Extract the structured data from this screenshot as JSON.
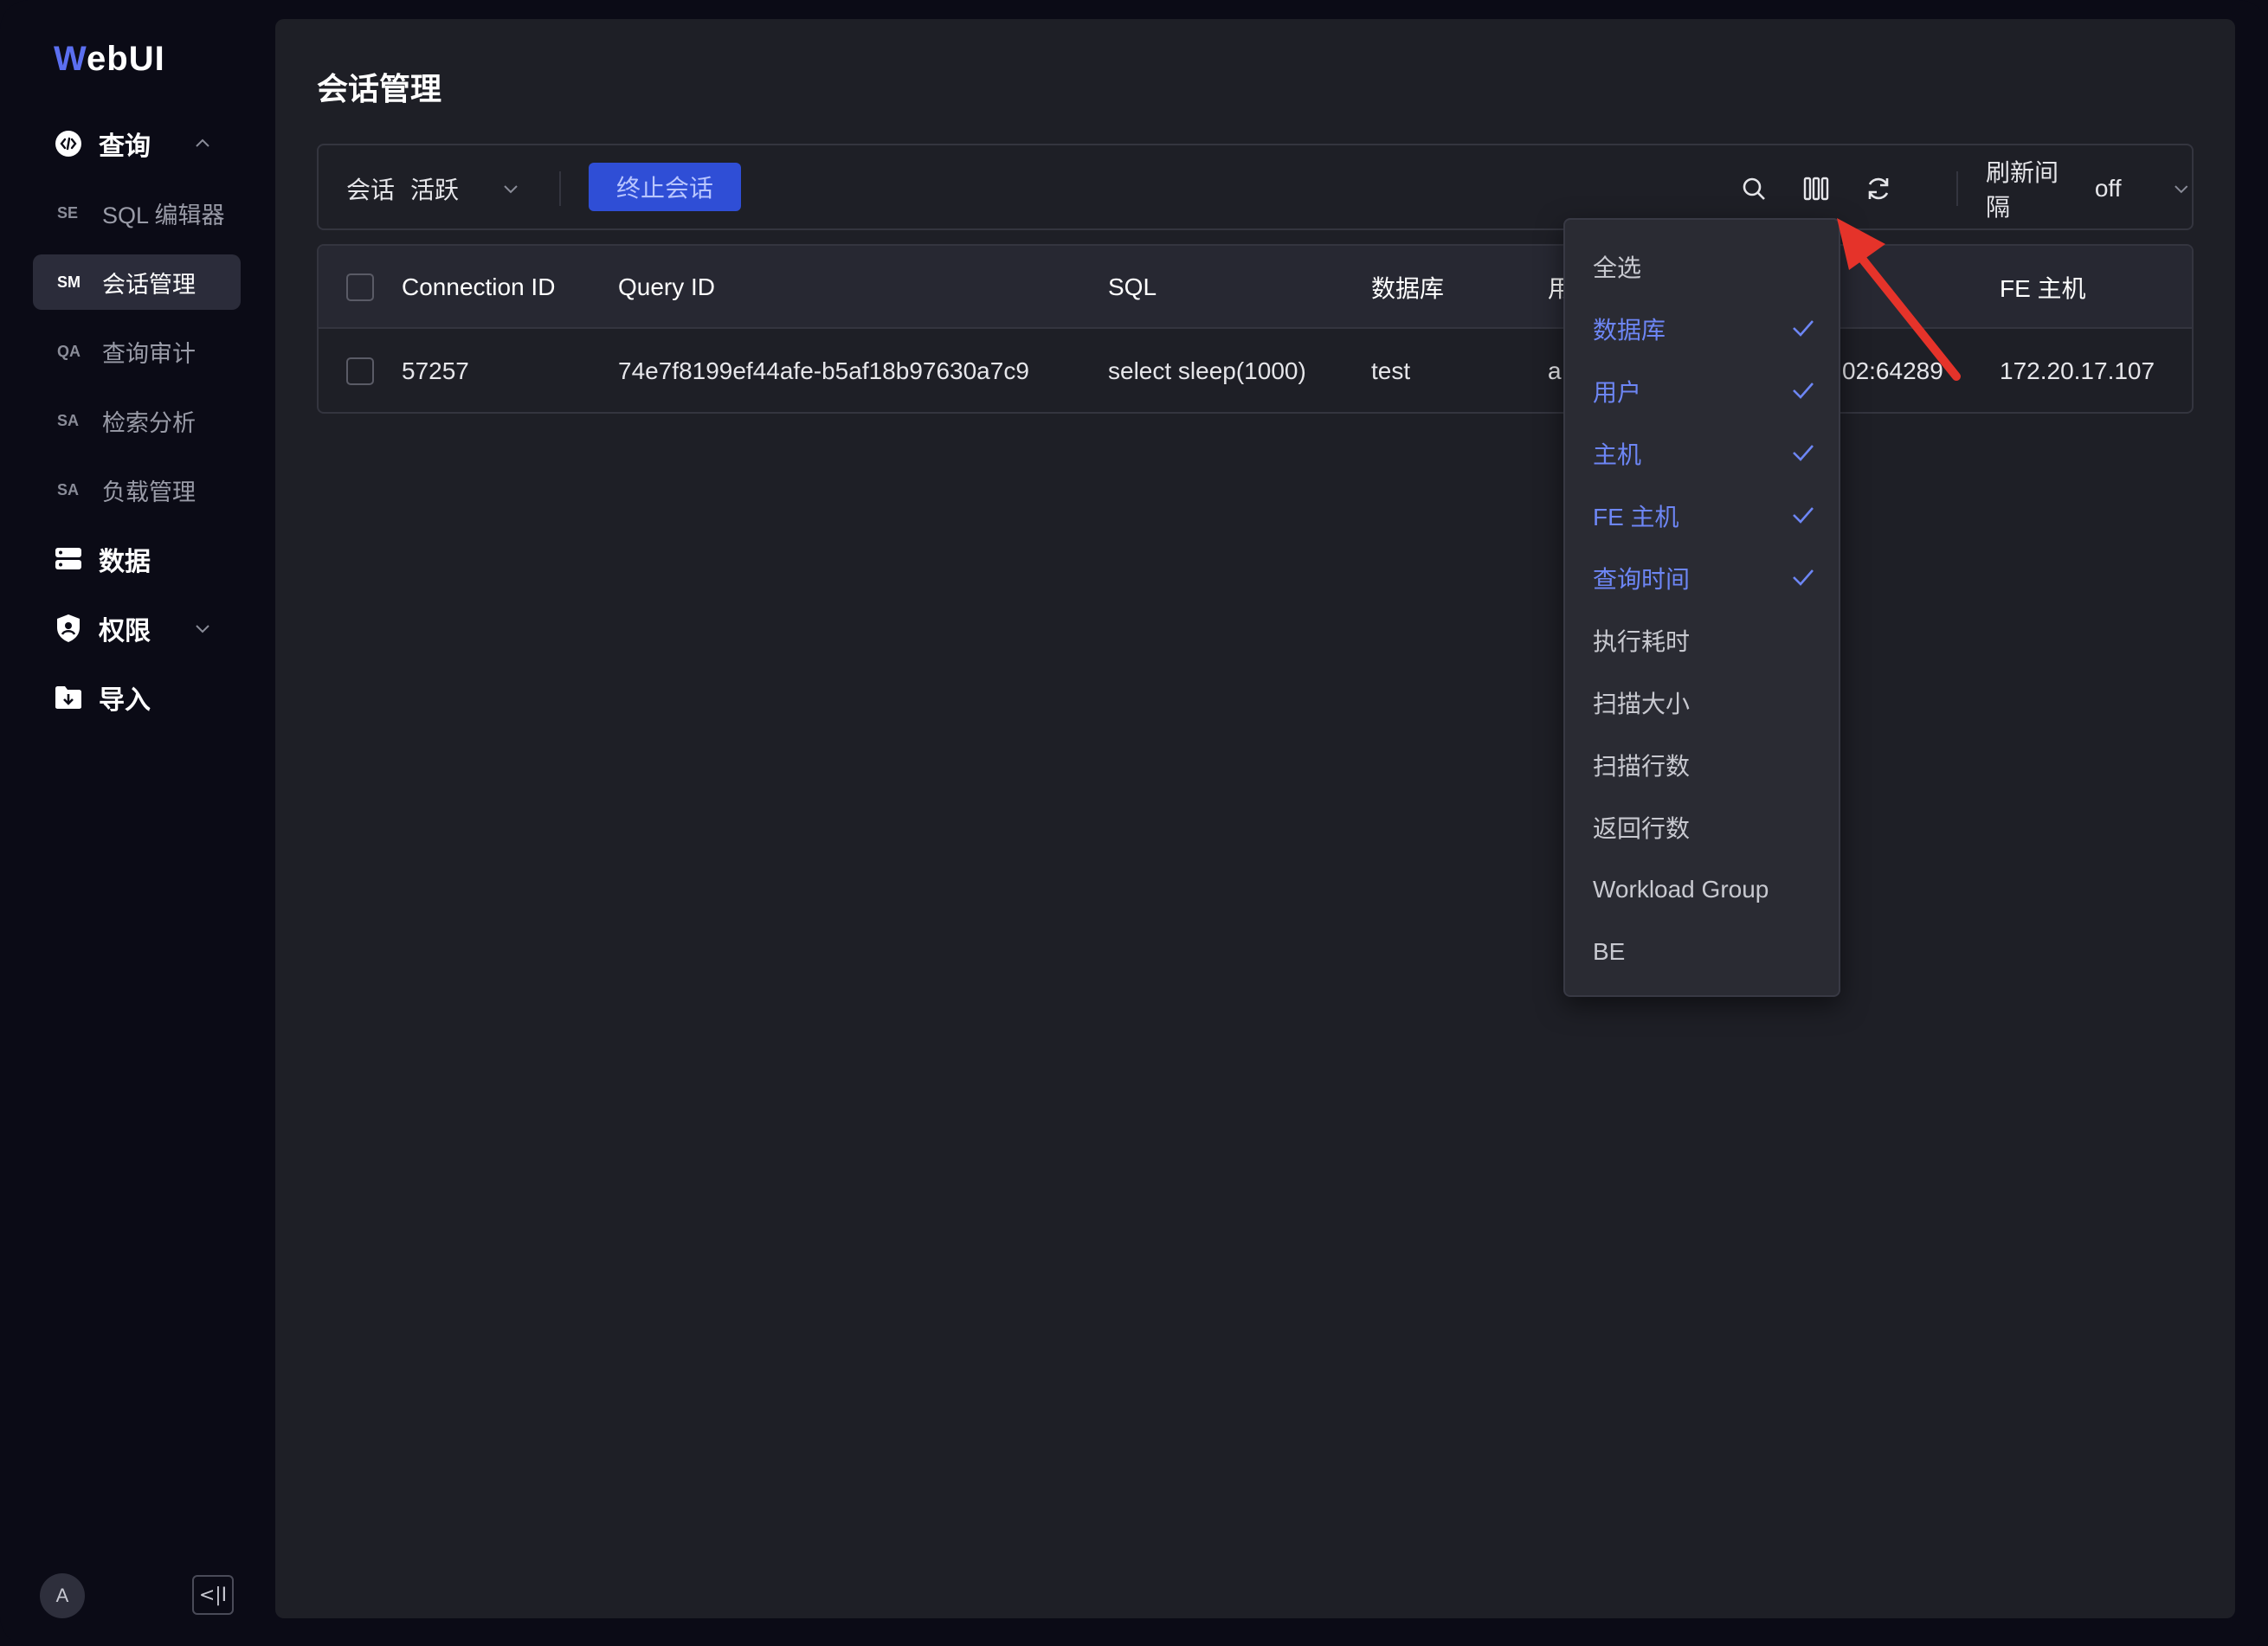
{
  "app": {
    "logo_prefix": "W",
    "logo_rest": "ebUI"
  },
  "sidebar": {
    "groups": [
      {
        "label": "查询",
        "icon": "code-icon"
      },
      {
        "label": "数据",
        "icon": "database-icon"
      },
      {
        "label": "权限",
        "icon": "shield-icon"
      },
      {
        "label": "导入",
        "icon": "import-icon"
      }
    ],
    "items": [
      {
        "abbr": "SE",
        "label": "SQL 编辑器"
      },
      {
        "abbr": "SM",
        "label": "会话管理"
      },
      {
        "abbr": "QA",
        "label": "查询审计"
      },
      {
        "abbr": "SA",
        "label": "检索分析"
      },
      {
        "abbr": "SA",
        "label": "负载管理"
      }
    ],
    "avatar": "A",
    "collapse_label": "<|I"
  },
  "page": {
    "title": "会话管理"
  },
  "toolbar": {
    "session_key": "会话",
    "session_value": "活跃",
    "kill_button": "终止会话",
    "refresh_key": "刷新间隔",
    "refresh_value": "off"
  },
  "table": {
    "headers": [
      "Connection ID",
      "Query ID",
      "SQL",
      "数据库",
      "用",
      "FE 主机"
    ],
    "rows": [
      [
        "57257",
        "74e7f8199ef44afe-b5af18b97630a7c9",
        "select sleep(1000)",
        "test",
        "a",
        "02:64289",
        "172.20.17.107"
      ]
    ]
  },
  "column_menu": {
    "items": [
      {
        "label": "全选",
        "checked": false
      },
      {
        "label": "数据库",
        "checked": true
      },
      {
        "label": "用户",
        "checked": true
      },
      {
        "label": "主机",
        "checked": true
      },
      {
        "label": "FE 主机",
        "checked": true
      },
      {
        "label": "查询时间",
        "checked": true
      },
      {
        "label": "执行耗时",
        "checked": false
      },
      {
        "label": "扫描大小",
        "checked": false
      },
      {
        "label": "扫描行数",
        "checked": false
      },
      {
        "label": "返回行数",
        "checked": false
      },
      {
        "label": "Workload Group",
        "checked": false
      },
      {
        "label": "BE",
        "checked": false
      }
    ]
  },
  "colors": {
    "accent": "#6d86f5",
    "button": "#2f4ed6",
    "annotation_arrow": "#e5332a"
  }
}
